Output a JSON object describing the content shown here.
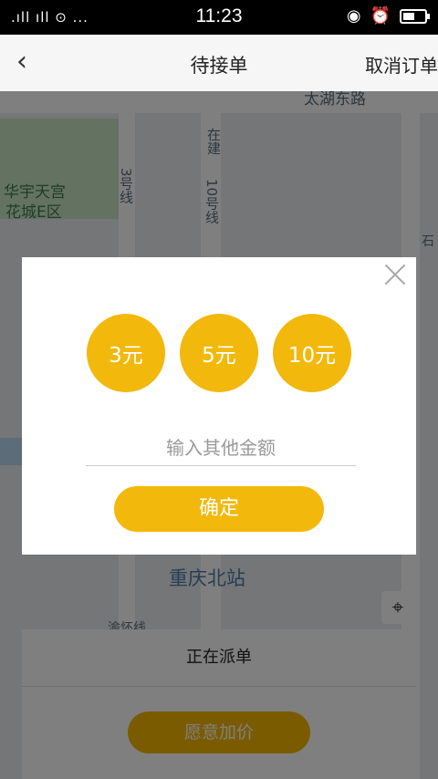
{
  "status_bar": {
    "signal_text": ".ıll ıll ⊙ ...",
    "time": "11:23"
  },
  "nav": {
    "title": "待接单",
    "action": "取消订单",
    "back_icon": "chevron-left-icon"
  },
  "map": {
    "labels": {
      "road_top": "太湖东路",
      "huayu": "华宇天宫",
      "huacheng": "花城E区",
      "line3": "3号线",
      "line10": "10号线",
      "zaijian": "在建",
      "shi": "石",
      "station": "重庆北站",
      "yuhai": "渝怀线"
    }
  },
  "bottom": {
    "dispatch_text": "正在派单",
    "willing_button": "愿意加价"
  },
  "modal": {
    "amounts": [
      "3元",
      "5元",
      "10元"
    ],
    "input_placeholder": "输入其他金额",
    "confirm": "确定"
  },
  "colors": {
    "accent": "#f2b80c",
    "overlay": "rgba(0,0,0,0.5)"
  }
}
